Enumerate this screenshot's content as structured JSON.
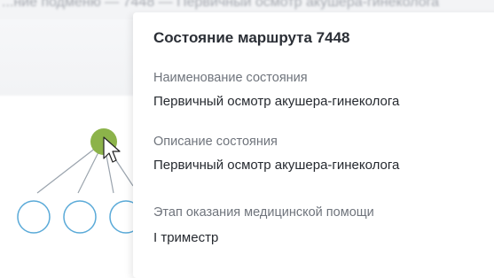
{
  "background": {
    "header_text": "...ние подменю — 7448 — Первичный осмотр акушера-гинеколога"
  },
  "route_tree": {
    "active_node_color": "#8cb34a",
    "node_outline_color": "#5aaad8",
    "edge_color": "#9aa3ad"
  },
  "popover": {
    "title": "Состояние маршрута 7448",
    "fields": [
      {
        "label": "Наименование состояния",
        "value": "Первичный осмотр акушера-гинеколога"
      },
      {
        "label": "Описание состояния",
        "value": "Первичный осмотр акушера-гинеколога"
      },
      {
        "label": "Этап оказания медицинской помощи",
        "value": "I триместр"
      }
    ]
  }
}
